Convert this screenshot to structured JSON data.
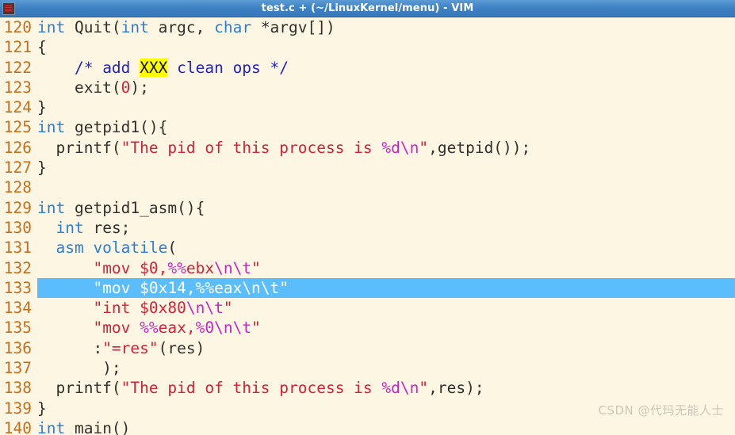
{
  "window": {
    "title": "test.c + (~/LinuxKernel/menu) - VIM",
    "app_icon": "vim-icon"
  },
  "editor": {
    "first_visible_line": 120,
    "cursor_line": 133,
    "colors": {
      "background": "#fdf6e3",
      "linenumber": "#c2701f",
      "foreground": "#32302c",
      "keyword": "#2b7fd4",
      "comment": "#2424c0",
      "string": "#d0223a",
      "format_spec": "#c327c3",
      "todo_highlight_bg": "#ffff00",
      "cursorline_bg": "#5cbdfc",
      "cursorline_fg": "#ffffff",
      "titlebar_bg": "#3f83c4"
    },
    "lines": [
      {
        "no": "120",
        "text": "int Quit(int argc, char *argv[])",
        "tokens": [
          {
            "t": "int",
            "c": "kw"
          },
          {
            "t": " Quit(",
            "c": "plain"
          },
          {
            "t": "int",
            "c": "kw"
          },
          {
            "t": " argc, ",
            "c": "plain"
          },
          {
            "t": "char",
            "c": "kw"
          },
          {
            "t": " *argv[])",
            "c": "plain"
          }
        ]
      },
      {
        "no": "121",
        "text": "{",
        "tokens": [
          {
            "t": "{",
            "c": "plain"
          }
        ]
      },
      {
        "no": "122",
        "text": "    /* add XXX clean ops */",
        "tokens": [
          {
            "t": "    ",
            "c": "plain"
          },
          {
            "t": "/* add ",
            "c": "cmt"
          },
          {
            "t": "XXX",
            "c": "todo"
          },
          {
            "t": " clean ops */",
            "c": "cmt"
          }
        ]
      },
      {
        "no": "123",
        "text": "    exit(0);",
        "tokens": [
          {
            "t": "    exit(",
            "c": "plain"
          },
          {
            "t": "0",
            "c": "num"
          },
          {
            "t": ");",
            "c": "plain"
          }
        ]
      },
      {
        "no": "124",
        "text": "}",
        "tokens": [
          {
            "t": "}",
            "c": "plain"
          }
        ]
      },
      {
        "no": "125",
        "text": "int getpid1(){",
        "tokens": [
          {
            "t": "int",
            "c": "kw"
          },
          {
            "t": " getpid1(){",
            "c": "plain"
          }
        ]
      },
      {
        "no": "126",
        "text": "  printf(\"The pid of this process is %d\\n\",getpid());",
        "tokens": [
          {
            "t": "  printf(",
            "c": "plain"
          },
          {
            "t": "\"The pid of this process is ",
            "c": "str"
          },
          {
            "t": "%d\\n",
            "c": "fmt"
          },
          {
            "t": "\"",
            "c": "str"
          },
          {
            "t": ",getpid());",
            "c": "plain"
          }
        ]
      },
      {
        "no": "127",
        "text": "}",
        "tokens": [
          {
            "t": "}",
            "c": "plain"
          }
        ]
      },
      {
        "no": "128",
        "text": "",
        "tokens": []
      },
      {
        "no": "129",
        "text": "int getpid1_asm(){",
        "tokens": [
          {
            "t": "int",
            "c": "kw"
          },
          {
            "t": " getpid1_asm(){",
            "c": "plain"
          }
        ]
      },
      {
        "no": "130",
        "text": "  int res;",
        "tokens": [
          {
            "t": "  ",
            "c": "plain"
          },
          {
            "t": "int",
            "c": "kw"
          },
          {
            "t": " res;",
            "c": "plain"
          }
        ]
      },
      {
        "no": "131",
        "text": "  asm volatile(",
        "tokens": [
          {
            "t": "  ",
            "c": "plain"
          },
          {
            "t": "asm volatile",
            "c": "kw"
          },
          {
            "t": "(",
            "c": "plain"
          }
        ]
      },
      {
        "no": "132",
        "text": "      \"mov $0,%%ebx\\n\\t\"",
        "tokens": [
          {
            "t": "      ",
            "c": "plain"
          },
          {
            "t": "\"mov $0,",
            "c": "str"
          },
          {
            "t": "%%",
            "c": "fmt"
          },
          {
            "t": "ebx",
            "c": "str"
          },
          {
            "t": "\\n\\t",
            "c": "fmt"
          },
          {
            "t": "\"",
            "c": "str"
          }
        ]
      },
      {
        "no": "133",
        "text": "      \"mov $0x14,%%eax\\n\\t\"",
        "cursor": true,
        "tokens": [
          {
            "t": "      ",
            "c": "plain"
          },
          {
            "t": "\"mov $0x14,",
            "c": "str"
          },
          {
            "t": "%%",
            "c": "fmt"
          },
          {
            "t": "eax",
            "c": "str"
          },
          {
            "t": "\\n\\t",
            "c": "fmt"
          },
          {
            "t": "\"",
            "c": "str"
          }
        ]
      },
      {
        "no": "134",
        "text": "      \"int $0x80\\n\\t\"",
        "tokens": [
          {
            "t": "      ",
            "c": "plain"
          },
          {
            "t": "\"int $0x80",
            "c": "str"
          },
          {
            "t": "\\n\\t",
            "c": "fmt"
          },
          {
            "t": "\"",
            "c": "str"
          }
        ]
      },
      {
        "no": "135",
        "text": "      \"mov %%eax,%0\\n\\t\"",
        "tokens": [
          {
            "t": "      ",
            "c": "plain"
          },
          {
            "t": "\"mov ",
            "c": "str"
          },
          {
            "t": "%%",
            "c": "fmt"
          },
          {
            "t": "eax,",
            "c": "str"
          },
          {
            "t": "%0",
            "c": "fmt"
          },
          {
            "t": "\\n\\t",
            "c": "fmt"
          },
          {
            "t": "\"",
            "c": "str"
          }
        ]
      },
      {
        "no": "136",
        "text": "      :\"=res\"(res)",
        "tokens": [
          {
            "t": "      :",
            "c": "plain"
          },
          {
            "t": "\"=res\"",
            "c": "str"
          },
          {
            "t": "(res)",
            "c": "plain"
          }
        ]
      },
      {
        "no": "137",
        "text": "       );",
        "tokens": [
          {
            "t": "       );",
            "c": "plain"
          }
        ]
      },
      {
        "no": "138",
        "text": "  printf(\"The pid of this process is %d\\n\",res);",
        "tokens": [
          {
            "t": "  printf(",
            "c": "plain"
          },
          {
            "t": "\"The pid of this process is ",
            "c": "str"
          },
          {
            "t": "%d\\n",
            "c": "fmt"
          },
          {
            "t": "\"",
            "c": "str"
          },
          {
            "t": ",res);",
            "c": "plain"
          }
        ]
      },
      {
        "no": "139",
        "text": "}",
        "tokens": [
          {
            "t": "}",
            "c": "plain"
          }
        ]
      },
      {
        "no": "140",
        "text": "int main()",
        "clipped": true,
        "tokens": [
          {
            "t": "int",
            "c": "kw"
          },
          {
            "t": " main()",
            "c": "plain"
          }
        ]
      }
    ]
  },
  "watermark": {
    "text": "CSDN @代玛无能人士"
  }
}
